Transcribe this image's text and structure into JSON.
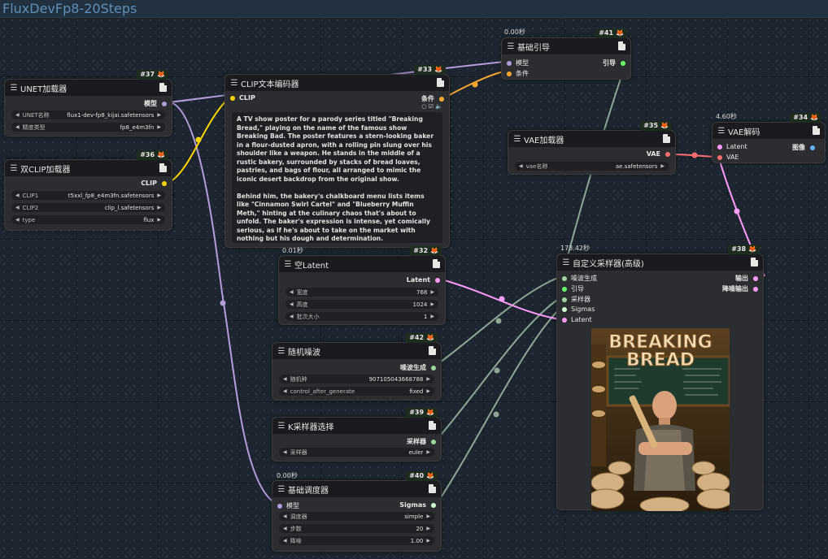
{
  "workflow": {
    "title": "FluxDevFp8-20Steps"
  },
  "colors": {
    "model": "#b39ddb",
    "clip": "#ffd500",
    "conditioning": "#ffa931",
    "vae": "#ff6e6e",
    "latent": "#ff9cf9",
    "image": "#64b5f6",
    "noise": "#a0d6a0",
    "guider": "#66ff66",
    "sigmas": "#cdffcd",
    "link_gray": "#8fa696"
  },
  "nodes": {
    "unet": {
      "id": "#37",
      "title": "UNET加载器",
      "output": "模型",
      "widgets": [
        {
          "label": "UNET名称",
          "value": "flux1-dev-fp8_kijai.safetensors"
        },
        {
          "label": "精度类型",
          "value": "fp8_e4m3fn"
        }
      ]
    },
    "dualclip": {
      "id": "#36",
      "title": "双CLIP加载器",
      "output": "CLIP",
      "widgets": [
        {
          "label": "CLIP1",
          "value": "t5xxl_fp8_e4m3fn.safetensors"
        },
        {
          "label": "CLIP2",
          "value": "clip_l.safetensors"
        },
        {
          "label": "type",
          "value": "flux"
        }
      ]
    },
    "clip_encode": {
      "id": "#33",
      "title": "CLIP文本编码器",
      "input": "CLIP",
      "output": "条件",
      "prompt": "A TV show poster for a parody series titled \"Breaking Bread,\" playing on the name of the famous show Breaking Bad. The poster features a stern-looking baker in a flour-dusted apron, with a rolling pin slung over his shoulder like a weapon. He stands in the middle of a rustic bakery, surrounded by stacks of bread loaves, pastries, and bags of flour, all arranged to mimic the iconic desert backdrop from the original show.\n\nBehind him, the bakery's chalkboard menu lists items like \"Cinnamon Swirl Cartel\" and \"Blueberry Muffin Meth,\" hinting at the culinary chaos that's about to unfold. The baker's expression is intense, yet comically serious, as if he's about to take on the market with nothing but his dough and determination.\n\nThe title \"Breaking Bread\" is displayed in bold, stylized text at the top, with the \"Breaking\" in a gritty, cracked font, while \"Bread\" is"
    },
    "basic_guider": {
      "id": "#41",
      "title": "基础引导",
      "timing": "0.00秒",
      "inputs": [
        "模型",
        "条件"
      ],
      "output": "引导"
    },
    "vae_loader": {
      "id": "#35",
      "title": "VAE加载器",
      "output": "VAE",
      "widgets": [
        {
          "label": "vae名称",
          "value": "ae.safetensors"
        }
      ]
    },
    "vae_decode": {
      "id": "#34",
      "title": "VAE解码",
      "timing": "4.60秒",
      "inputs": [
        "Latent",
        "VAE"
      ],
      "output": "图像"
    },
    "empty_latent": {
      "id": "#32",
      "title": "空Latent",
      "timing": "0.01秒",
      "output": "Latent",
      "widgets": [
        {
          "label": "宽度",
          "value": "768"
        },
        {
          "label": "高度",
          "value": "1024"
        },
        {
          "label": "批次大小",
          "value": "1"
        }
      ]
    },
    "random_noise": {
      "id": "#42",
      "title": "随机噪波",
      "output": "噪波生成",
      "widgets": [
        {
          "label": "随机种",
          "value": "907105043668788"
        },
        {
          "label": "control_after_generate",
          "value": "fixed"
        }
      ]
    },
    "ksampler_select": {
      "id": "#39",
      "title": "K采样器选择",
      "output": "采样器",
      "widgets": [
        {
          "label": "采样器",
          "value": "euler"
        }
      ]
    },
    "basic_scheduler": {
      "id": "#40",
      "title": "基础调度器",
      "timing": "0.00秒",
      "input": "模型",
      "output": "Sigmas",
      "widgets": [
        {
          "label": "调度器",
          "value": "simple"
        },
        {
          "label": "步数",
          "value": "20"
        },
        {
          "label": "降噪",
          "value": "1.00"
        }
      ]
    },
    "custom_sampler": {
      "id": "#38",
      "title": "自定义采样器(高级)",
      "timing": "173.42秒",
      "inputs": [
        "噪波生成",
        "引导",
        "采样器",
        "Sigmas",
        "Latent"
      ],
      "outputs": [
        "输出",
        "降噪输出"
      ],
      "preview": {
        "headline_1": "BREAKING",
        "headline_2": "BREAD"
      }
    }
  }
}
